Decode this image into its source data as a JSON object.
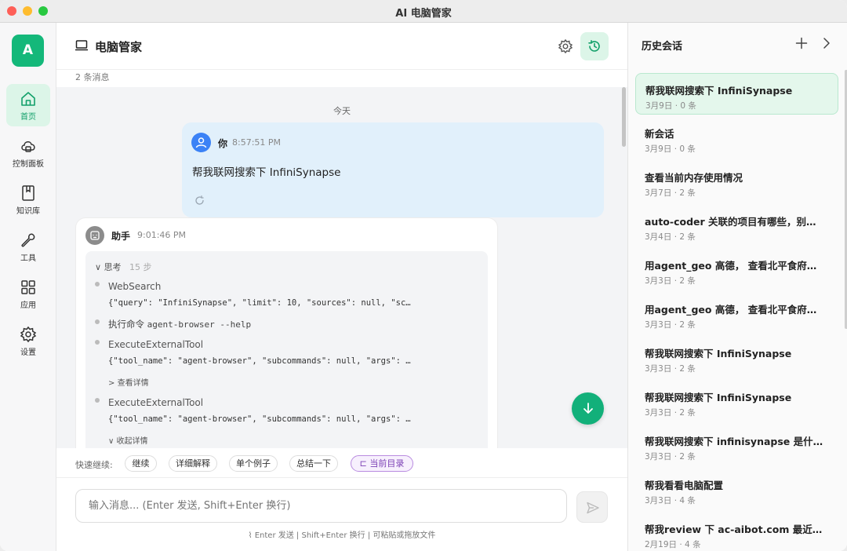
{
  "window": {
    "title": "AI 电脑管家"
  },
  "rail": {
    "avatar_letter": "A",
    "items": [
      {
        "label": "首页",
        "icon": "home-icon",
        "active": true
      },
      {
        "label": "控制面板",
        "icon": "cloud-panel-icon",
        "active": false
      },
      {
        "label": "知识库",
        "icon": "book-icon",
        "active": false
      },
      {
        "label": "工具",
        "icon": "wrench-icon",
        "active": false
      },
      {
        "label": "应用",
        "icon": "grid-icon",
        "active": false
      },
      {
        "label": "设置",
        "icon": "gear-icon",
        "active": false
      }
    ]
  },
  "main": {
    "title": "电脑管家",
    "message_count": "2 条消息",
    "day_label": "今天",
    "user_message": {
      "sender": "你",
      "time": "8:57:51 PM",
      "text": "帮我联网搜索下 InfiniSynapse"
    },
    "assistant_message": {
      "sender": "助手",
      "time": "9:01:46 PM",
      "thinking_label": "思考",
      "thinking_steps": "15 步",
      "steps": [
        {
          "name": "WebSearch",
          "args": "{\"query\": \"InfiniSynapse\", \"limit\": 10, \"sources\": null, \"sc…"
        },
        {
          "prefix": "执行命令",
          "command": "agent-browser --help"
        },
        {
          "name": "ExecuteExternalTool",
          "args": "{\"tool_name\": \"agent-browser\", \"subcommands\": null, \"args\": …",
          "detail": "查看详情"
        },
        {
          "name": "ExecuteExternalTool",
          "args": "{\"tool_name\": \"agent-browser\", \"subcommands\": null, \"args\": …",
          "detail": "收起详情"
        }
      ]
    },
    "quick": {
      "label": "快速继续:",
      "chips": [
        "继续",
        "详细解释",
        "单个例子",
        "总结一下",
        "当前目录"
      ]
    },
    "composer": {
      "placeholder": "输入消息... (Enter 发送, Shift+Enter 换行)",
      "hint": "Enter 发送 | Shift+Enter 换行 | 可粘贴或拖放文件"
    }
  },
  "history": {
    "title": "历史会话",
    "items": [
      {
        "title": "帮我联网搜索下 InfiniSynapse",
        "meta": "3月9日 · 0 条",
        "active": true
      },
      {
        "title": "新会话",
        "meta": "3月9日 · 0 条"
      },
      {
        "title": "查看当前内存使用情况",
        "meta": "3月7日 · 2 条"
      },
      {
        "title": "auto-coder 关联的项目有哪些，别…",
        "meta": "3月4日 · 2 条"
      },
      {
        "title": "用agent_geo 高德， 查看北平食府…",
        "meta": "3月3日 · 2 条"
      },
      {
        "title": "用agent_geo 高德， 查看北平食府…",
        "meta": "3月3日 · 2 条"
      },
      {
        "title": "帮我联网搜索下 InfiniSynapse",
        "meta": "3月3日 · 2 条"
      },
      {
        "title": "帮我联网搜索下 InfiniSynapse",
        "meta": "3月3日 · 2 条"
      },
      {
        "title": "帮我联网搜索下 infinisynapse 是什…",
        "meta": "3月3日 · 2 条"
      },
      {
        "title": "帮我看看电脑配置",
        "meta": "3月3日 · 4 条"
      },
      {
        "title": "帮我review 下 ac-aibot.com 最近…",
        "meta": "2月19日 · 4 条"
      }
    ]
  }
}
